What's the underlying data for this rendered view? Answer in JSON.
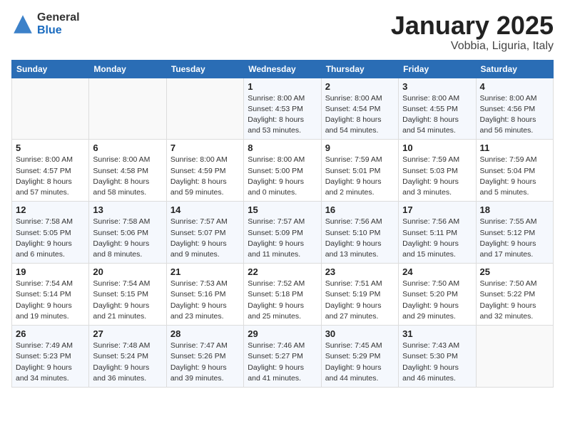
{
  "header": {
    "logo_general": "General",
    "logo_blue": "Blue",
    "title": "January 2025",
    "location": "Vobbia, Liguria, Italy"
  },
  "weekdays": [
    "Sunday",
    "Monday",
    "Tuesday",
    "Wednesday",
    "Thursday",
    "Friday",
    "Saturday"
  ],
  "weeks": [
    [
      {
        "day": "",
        "info": ""
      },
      {
        "day": "",
        "info": ""
      },
      {
        "day": "",
        "info": ""
      },
      {
        "day": "1",
        "info": "Sunrise: 8:00 AM\nSunset: 4:53 PM\nDaylight: 8 hours\nand 53 minutes."
      },
      {
        "day": "2",
        "info": "Sunrise: 8:00 AM\nSunset: 4:54 PM\nDaylight: 8 hours\nand 54 minutes."
      },
      {
        "day": "3",
        "info": "Sunrise: 8:00 AM\nSunset: 4:55 PM\nDaylight: 8 hours\nand 54 minutes."
      },
      {
        "day": "4",
        "info": "Sunrise: 8:00 AM\nSunset: 4:56 PM\nDaylight: 8 hours\nand 56 minutes."
      }
    ],
    [
      {
        "day": "5",
        "info": "Sunrise: 8:00 AM\nSunset: 4:57 PM\nDaylight: 8 hours\nand 57 minutes."
      },
      {
        "day": "6",
        "info": "Sunrise: 8:00 AM\nSunset: 4:58 PM\nDaylight: 8 hours\nand 58 minutes."
      },
      {
        "day": "7",
        "info": "Sunrise: 8:00 AM\nSunset: 4:59 PM\nDaylight: 8 hours\nand 59 minutes."
      },
      {
        "day": "8",
        "info": "Sunrise: 8:00 AM\nSunset: 5:00 PM\nDaylight: 9 hours\nand 0 minutes."
      },
      {
        "day": "9",
        "info": "Sunrise: 7:59 AM\nSunset: 5:01 PM\nDaylight: 9 hours\nand 2 minutes."
      },
      {
        "day": "10",
        "info": "Sunrise: 7:59 AM\nSunset: 5:03 PM\nDaylight: 9 hours\nand 3 minutes."
      },
      {
        "day": "11",
        "info": "Sunrise: 7:59 AM\nSunset: 5:04 PM\nDaylight: 9 hours\nand 5 minutes."
      }
    ],
    [
      {
        "day": "12",
        "info": "Sunrise: 7:58 AM\nSunset: 5:05 PM\nDaylight: 9 hours\nand 6 minutes."
      },
      {
        "day": "13",
        "info": "Sunrise: 7:58 AM\nSunset: 5:06 PM\nDaylight: 9 hours\nand 8 minutes."
      },
      {
        "day": "14",
        "info": "Sunrise: 7:57 AM\nSunset: 5:07 PM\nDaylight: 9 hours\nand 9 minutes."
      },
      {
        "day": "15",
        "info": "Sunrise: 7:57 AM\nSunset: 5:09 PM\nDaylight: 9 hours\nand 11 minutes."
      },
      {
        "day": "16",
        "info": "Sunrise: 7:56 AM\nSunset: 5:10 PM\nDaylight: 9 hours\nand 13 minutes."
      },
      {
        "day": "17",
        "info": "Sunrise: 7:56 AM\nSunset: 5:11 PM\nDaylight: 9 hours\nand 15 minutes."
      },
      {
        "day": "18",
        "info": "Sunrise: 7:55 AM\nSunset: 5:12 PM\nDaylight: 9 hours\nand 17 minutes."
      }
    ],
    [
      {
        "day": "19",
        "info": "Sunrise: 7:54 AM\nSunset: 5:14 PM\nDaylight: 9 hours\nand 19 minutes."
      },
      {
        "day": "20",
        "info": "Sunrise: 7:54 AM\nSunset: 5:15 PM\nDaylight: 9 hours\nand 21 minutes."
      },
      {
        "day": "21",
        "info": "Sunrise: 7:53 AM\nSunset: 5:16 PM\nDaylight: 9 hours\nand 23 minutes."
      },
      {
        "day": "22",
        "info": "Sunrise: 7:52 AM\nSunset: 5:18 PM\nDaylight: 9 hours\nand 25 minutes."
      },
      {
        "day": "23",
        "info": "Sunrise: 7:51 AM\nSunset: 5:19 PM\nDaylight: 9 hours\nand 27 minutes."
      },
      {
        "day": "24",
        "info": "Sunrise: 7:50 AM\nSunset: 5:20 PM\nDaylight: 9 hours\nand 29 minutes."
      },
      {
        "day": "25",
        "info": "Sunrise: 7:50 AM\nSunset: 5:22 PM\nDaylight: 9 hours\nand 32 minutes."
      }
    ],
    [
      {
        "day": "26",
        "info": "Sunrise: 7:49 AM\nSunset: 5:23 PM\nDaylight: 9 hours\nand 34 minutes."
      },
      {
        "day": "27",
        "info": "Sunrise: 7:48 AM\nSunset: 5:24 PM\nDaylight: 9 hours\nand 36 minutes."
      },
      {
        "day": "28",
        "info": "Sunrise: 7:47 AM\nSunset: 5:26 PM\nDaylight: 9 hours\nand 39 minutes."
      },
      {
        "day": "29",
        "info": "Sunrise: 7:46 AM\nSunset: 5:27 PM\nDaylight: 9 hours\nand 41 minutes."
      },
      {
        "day": "30",
        "info": "Sunrise: 7:45 AM\nSunset: 5:29 PM\nDaylight: 9 hours\nand 44 minutes."
      },
      {
        "day": "31",
        "info": "Sunrise: 7:43 AM\nSunset: 5:30 PM\nDaylight: 9 hours\nand 46 minutes."
      },
      {
        "day": "",
        "info": ""
      }
    ]
  ]
}
